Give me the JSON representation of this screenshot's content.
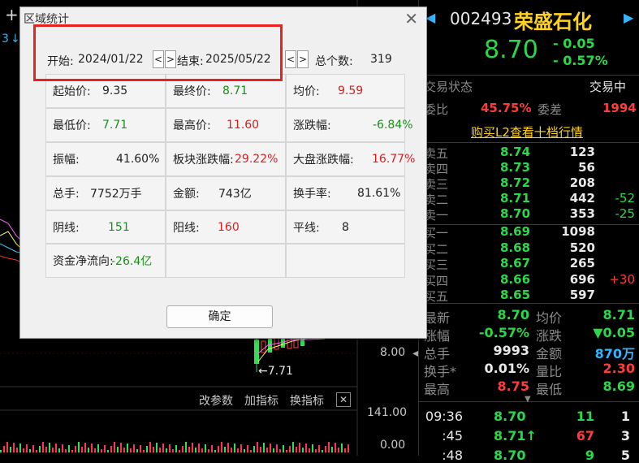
{
  "background": {
    "top_left_plus": "+",
    "left_number": "3",
    "price_axis": {
      "label_8": "8.00",
      "vol_141": "141.00",
      "vol_0": "0.00"
    },
    "low_annotation": "←7.71",
    "toolbar": {
      "change_params": "改参数",
      "add_indicator": "加指标",
      "switch_indicator": "换指标",
      "close": "✕"
    }
  },
  "dialog": {
    "title": "区域统计",
    "close": "✕",
    "start_label": "开始:",
    "start_date": "2024/01/22",
    "end_label": "结束:",
    "end_date": "2025/05/22",
    "prev": "<",
    "next": ">",
    "count_label": "总个数:",
    "count_value": "319",
    "ok_label": "确定",
    "rows": [
      [
        {
          "label": "起始价:",
          "value": "9.35",
          "tone": "vk"
        },
        {
          "label": "最终价:",
          "value": "8.71",
          "tone": "vg"
        },
        {
          "label": "均价:",
          "value": "9.59",
          "tone": "vr"
        }
      ],
      [
        {
          "label": "最低价:",
          "value": "7.71",
          "tone": "vg"
        },
        {
          "label": "最高价:",
          "value": "11.60",
          "tone": "vr"
        },
        {
          "label": "涨跌幅:",
          "value": "-6.84%",
          "tone": "vg"
        }
      ],
      [
        {
          "label": "振幅:",
          "value": "41.60%",
          "tone": "vk"
        },
        {
          "label": "板块涨跌幅:",
          "value": "29.22%",
          "tone": "vr"
        },
        {
          "label": "大盘涨跌幅:",
          "value": "16.77%",
          "tone": "vr"
        }
      ],
      [
        {
          "label": "总手:",
          "value": "7752万手",
          "tone": "vk"
        },
        {
          "label": "金额:",
          "value": "743亿",
          "tone": "vk"
        },
        {
          "label": "换手率:",
          "value": "81.61%",
          "tone": "vk"
        }
      ],
      [
        {
          "label": "阴线:",
          "value": "151",
          "tone": "vg"
        },
        {
          "label": "阳线:",
          "value": "160",
          "tone": "vr"
        },
        {
          "label": "平线:",
          "value": "8",
          "tone": "vk"
        }
      ],
      [
        {
          "label": "资金净流向:",
          "value": "-26.4亿",
          "tone": "vg"
        },
        {
          "label": "",
          "value": "",
          "tone": "vk"
        },
        {
          "label": "",
          "value": "",
          "tone": "vk"
        }
      ]
    ]
  },
  "quote": {
    "code": "002493",
    "name": "荣盛石化",
    "price": "8.70",
    "change": "- 0.05",
    "change_pct": "- 0.57%",
    "status_label": "交易状态",
    "status_value": "交易中",
    "weibi_label": "委比",
    "weibi_value": "45.75%",
    "weicha_label": "委差",
    "weicha_value": "1994",
    "l2_link": "购买L2查看十档行情",
    "asks": [
      {
        "label": "卖五",
        "price": "8.74",
        "vol": "123",
        "chg": ""
      },
      {
        "label": "卖四",
        "price": "8.73",
        "vol": "56",
        "chg": ""
      },
      {
        "label": "卖三",
        "price": "8.72",
        "vol": "208",
        "chg": ""
      },
      {
        "label": "卖二",
        "price": "8.71",
        "vol": "442",
        "chg": "-52"
      },
      {
        "label": "卖一",
        "price": "8.70",
        "vol": "353",
        "chg": "-25"
      }
    ],
    "bids": [
      {
        "label": "买一",
        "price": "8.69",
        "vol": "1098",
        "chg": ""
      },
      {
        "label": "买二",
        "price": "8.68",
        "vol": "520",
        "chg": ""
      },
      {
        "label": "买三",
        "price": "8.67",
        "vol": "265",
        "chg": ""
      },
      {
        "label": "买四",
        "price": "8.66",
        "vol": "696",
        "chg": "+30"
      },
      {
        "label": "买五",
        "price": "8.65",
        "vol": "597",
        "chg": ""
      }
    ],
    "stats": [
      {
        "l1": "最新",
        "v1": "8.70",
        "l2": "均价",
        "v2": "8.71"
      },
      {
        "l1": "涨幅",
        "v1": "-0.57%",
        "l2": "涨跌",
        "v2": "▼0.05"
      },
      {
        "l1": "总手",
        "v1": "9993",
        "l2": "金额",
        "v2": "870万"
      },
      {
        "l1": "换手*",
        "v1": "0.01%",
        "l2": "量比",
        "v2": "2.30"
      },
      {
        "l1": "最高",
        "v1": "8.75",
        "l2": "最低",
        "v2": "8.69"
      }
    ],
    "ticks": [
      {
        "time": "09:36",
        "price": "8.70",
        "vol": "11",
        "n": "1"
      },
      {
        "time": ":45",
        "price": "8.71↑",
        "vol": "67",
        "n": "3"
      },
      {
        "time": ":48",
        "price": "8.70",
        "vol": "9",
        "n": "5"
      }
    ]
  }
}
